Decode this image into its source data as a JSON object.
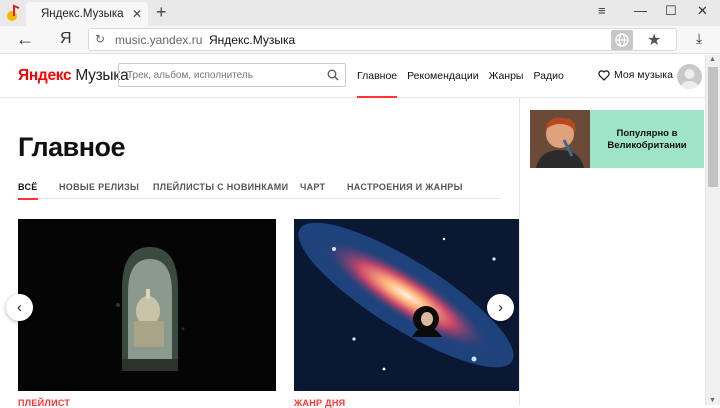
{
  "browser": {
    "tab_title": "Яндекс.Музыка",
    "tab_close": "✕",
    "new_tab": "+",
    "back": "←",
    "yandex_button": "Я",
    "reload": "↻",
    "domain": "music.yandex.ru",
    "page_title": "Яндекс.Музыка",
    "bookmark_icon": "★",
    "download_icon": "⤓",
    "minimize": "—",
    "maximize": "☐",
    "close": "✕",
    "menu": "≡"
  },
  "header": {
    "logo_brand": "Яндекс",
    "logo_product": "Музыка",
    "search_placeholder": "Трек, альбом, исполнитель",
    "nav": [
      "Главное",
      "Рекомендации",
      "Жанры",
      "Радио"
    ],
    "my_music": "Моя музыка"
  },
  "main": {
    "title": "Главное",
    "subtabs": [
      "ВСЁ",
      "НОВЫЕ РЕЛИЗЫ",
      "ПЛЕЙЛИСТЫ С НОВИНКАМИ",
      "ЧАРТ",
      "НАСТРОЕНИЯ И ЖАНРЫ"
    ],
    "cards": [
      {
        "label": "ПЛЕЙЛИСТ"
      },
      {
        "label": "ЖАНР ДНЯ"
      }
    ],
    "arrow_prev": "‹",
    "arrow_next": "›"
  },
  "sidebar": {
    "promo_line1": "Популярно в",
    "promo_line2": "Великобритании"
  },
  "colors": {
    "accent": "#ff3333",
    "promo_bg": "#9fe3c8"
  }
}
